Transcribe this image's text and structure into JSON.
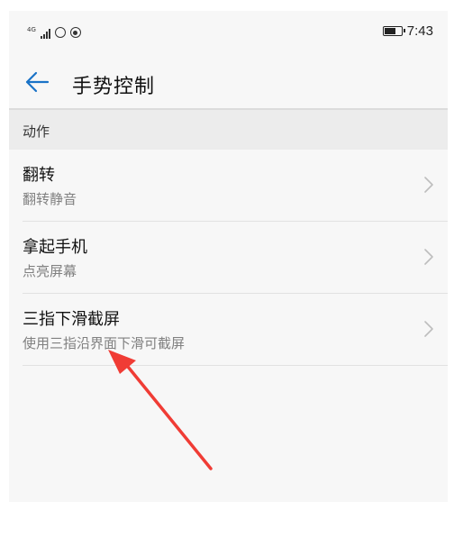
{
  "status_bar": {
    "network_label": "4G",
    "signal_strength": 4,
    "time": "7:43",
    "battery_level": 0.7
  },
  "header": {
    "title": "手势控制",
    "back_icon": "arrow-left-icon"
  },
  "section": {
    "label": "动作"
  },
  "items": [
    {
      "title": "翻转",
      "subtitle": "翻转静音"
    },
    {
      "title": "拿起手机",
      "subtitle": "点亮屏幕"
    },
    {
      "title": "三指下滑截屏",
      "subtitle": "使用三指沿界面下滑可截屏"
    }
  ],
  "colors": {
    "accent": "#1a73c7",
    "annotation_arrow": "#f03c35",
    "section_bg": "#ececec",
    "subtitle_text": "#808080"
  }
}
